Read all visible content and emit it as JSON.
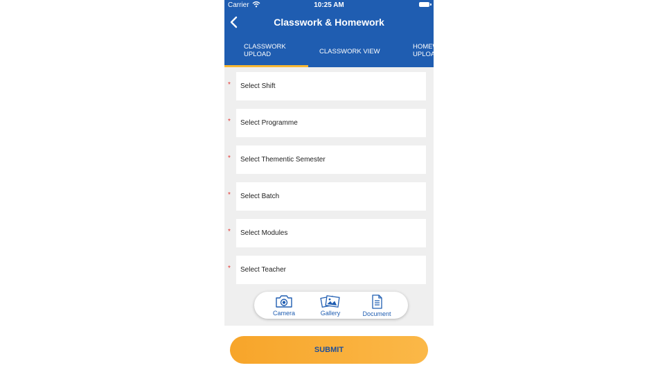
{
  "status_bar": {
    "carrier": "Carrier",
    "time": "10:25 AM"
  },
  "nav": {
    "title": "Classwork & Homework"
  },
  "tabs": [
    {
      "line1": "CLASSWORK",
      "line2": "UPLOAD",
      "active": true
    },
    {
      "line1": "CLASSWORK VIEW",
      "line2": "",
      "active": false
    },
    {
      "line1": "HOMEW",
      "line2": "UPLOA",
      "active": false
    }
  ],
  "form": {
    "required_marker": "*",
    "fields": [
      {
        "label": "Select Shift"
      },
      {
        "label": "Select Programme"
      },
      {
        "label": "Select Thementic Semester"
      },
      {
        "label": "Select Batch"
      },
      {
        "label": "Select Modules"
      },
      {
        "label": "Select Teacher"
      }
    ]
  },
  "attachments": {
    "camera": {
      "label": "Camera",
      "icon": "camera-icon"
    },
    "gallery": {
      "label": "Gallery",
      "icon": "gallery-icon"
    },
    "document": {
      "label": "Document",
      "icon": "document-icon"
    }
  },
  "submit_label": "SUBMIT",
  "colors": {
    "primary": "#1f5db1",
    "accent": "#f7b733",
    "required": "#e53935",
    "button_gradient_start": "#f7a52a",
    "button_gradient_end": "#fbb848",
    "background": "#efefef"
  }
}
